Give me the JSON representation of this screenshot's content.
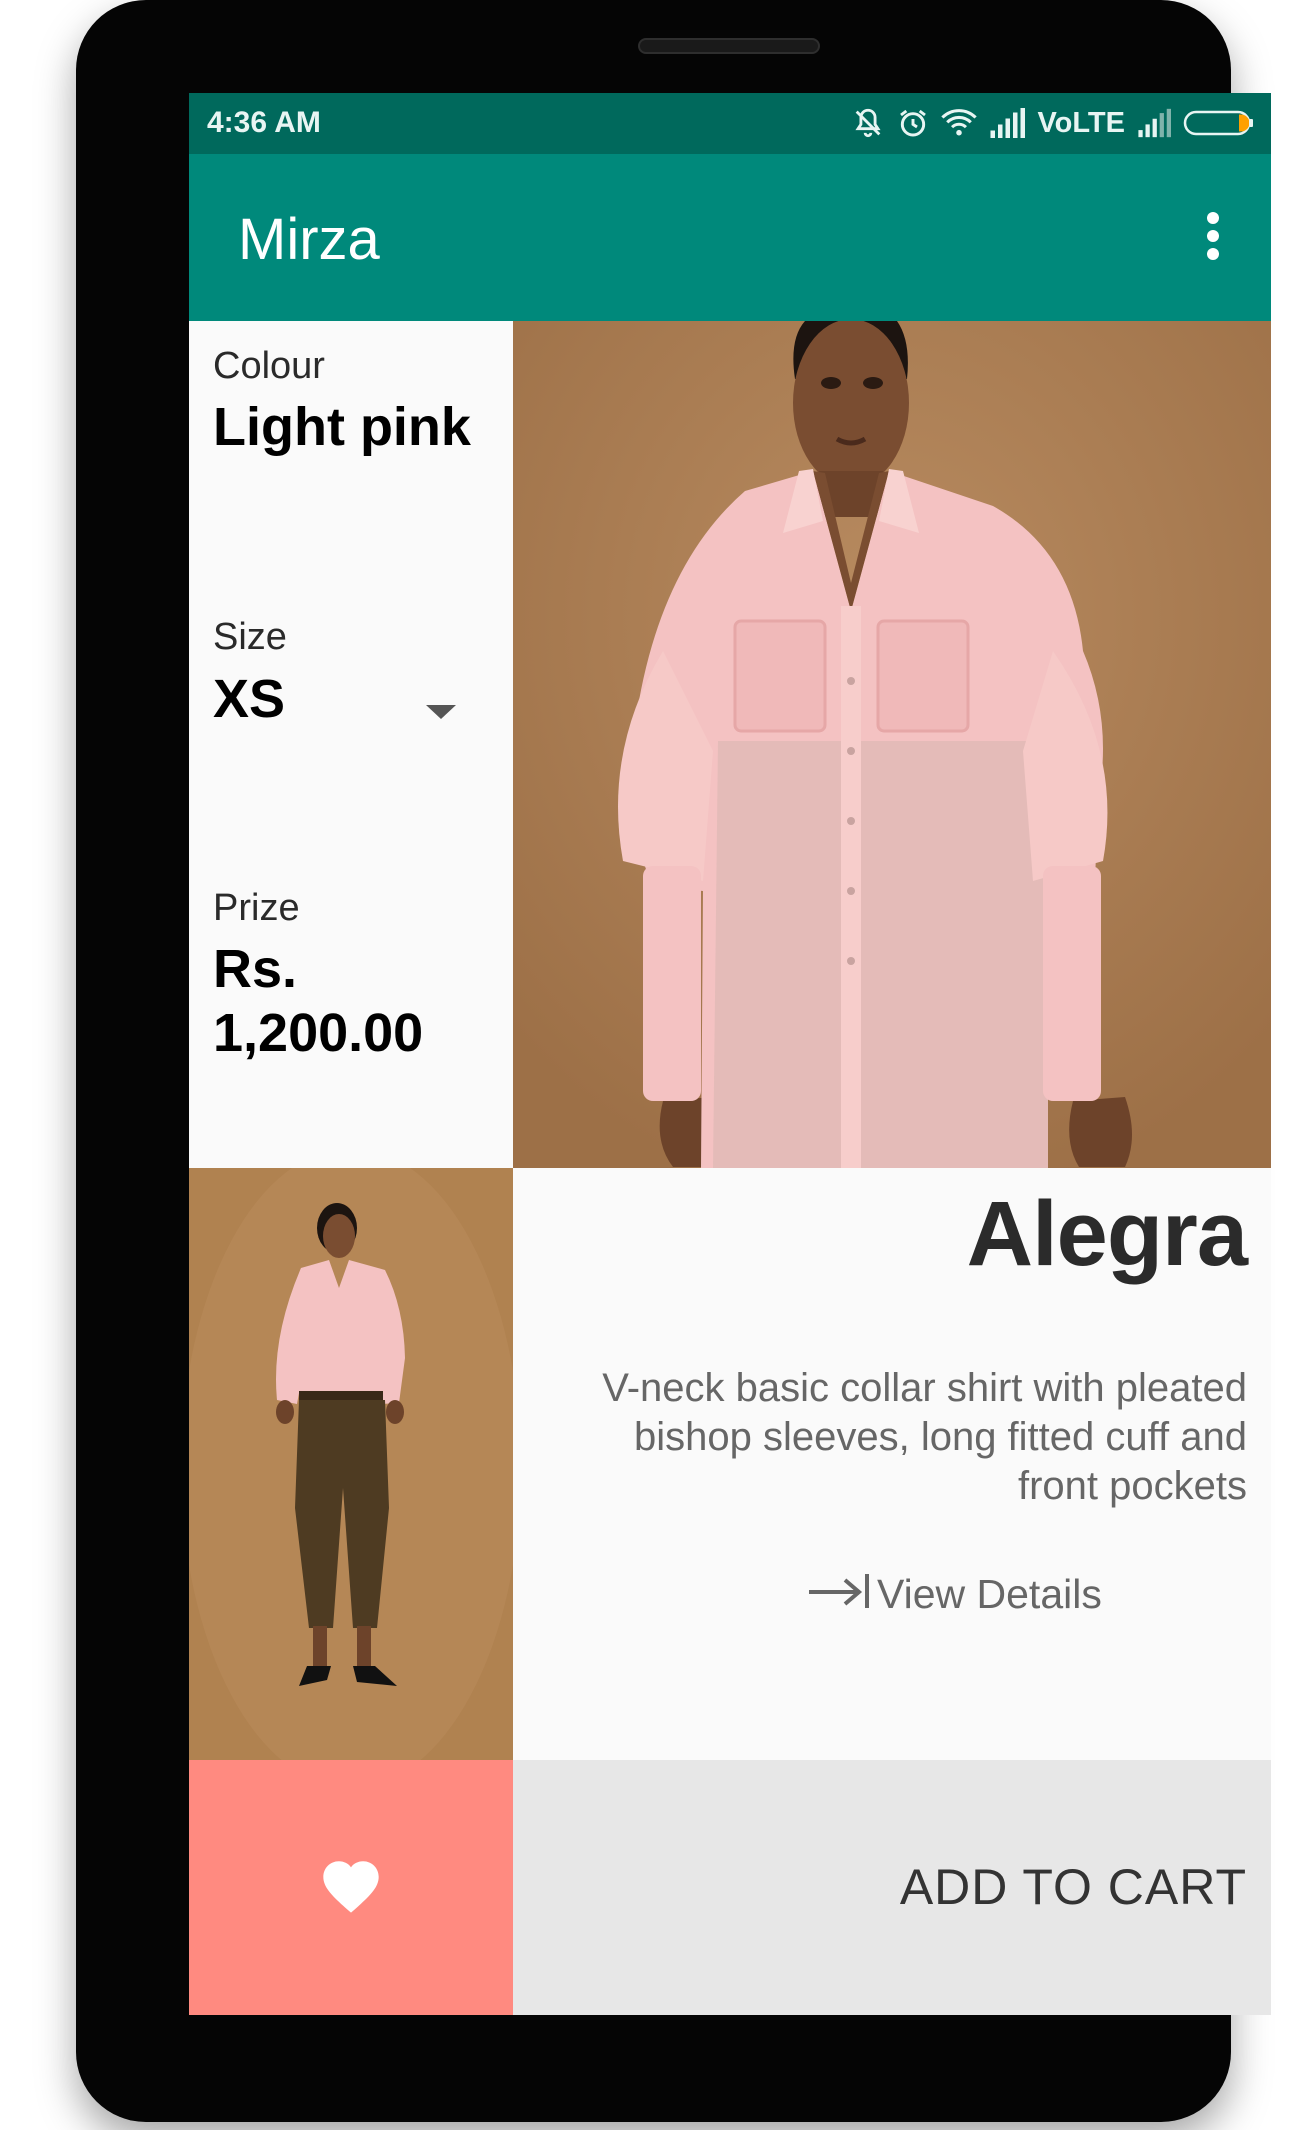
{
  "status_bar": {
    "time": "4:36 AM",
    "network_label": "VoLTE",
    "icons": [
      "mute-vibrate-icon",
      "alarm-icon",
      "wifi-icon",
      "signal-icon",
      "signal-2-icon",
      "battery-icon"
    ]
  },
  "app_bar": {
    "title": "Mirza",
    "menu_icon": "more-vert-icon"
  },
  "product": {
    "colour_label": "Colour",
    "colour_value": "Light pink",
    "size_label": "Size",
    "size_value": "XS",
    "price_label": "Prize",
    "price_line1": "Rs.",
    "price_line2": "1,200.00",
    "name": "Alegra",
    "description": "V-neck basic collar shirt with pleated bishop sleeves, long fitted cuff and front pockets",
    "view_details_label": "View Details",
    "view_details_icon": "arrow-right-to-line-icon"
  },
  "actions": {
    "favorite_icon": "heart-icon",
    "add_to_cart_label": "ADD TO CART"
  },
  "colors": {
    "status_bar": "#00695c",
    "app_bar": "#00897b",
    "favorite_bg": "#ff8a80",
    "cart_bg": "#e7e7e7",
    "shirt": "#f4c2c2",
    "backdrop": "#a6784f"
  }
}
